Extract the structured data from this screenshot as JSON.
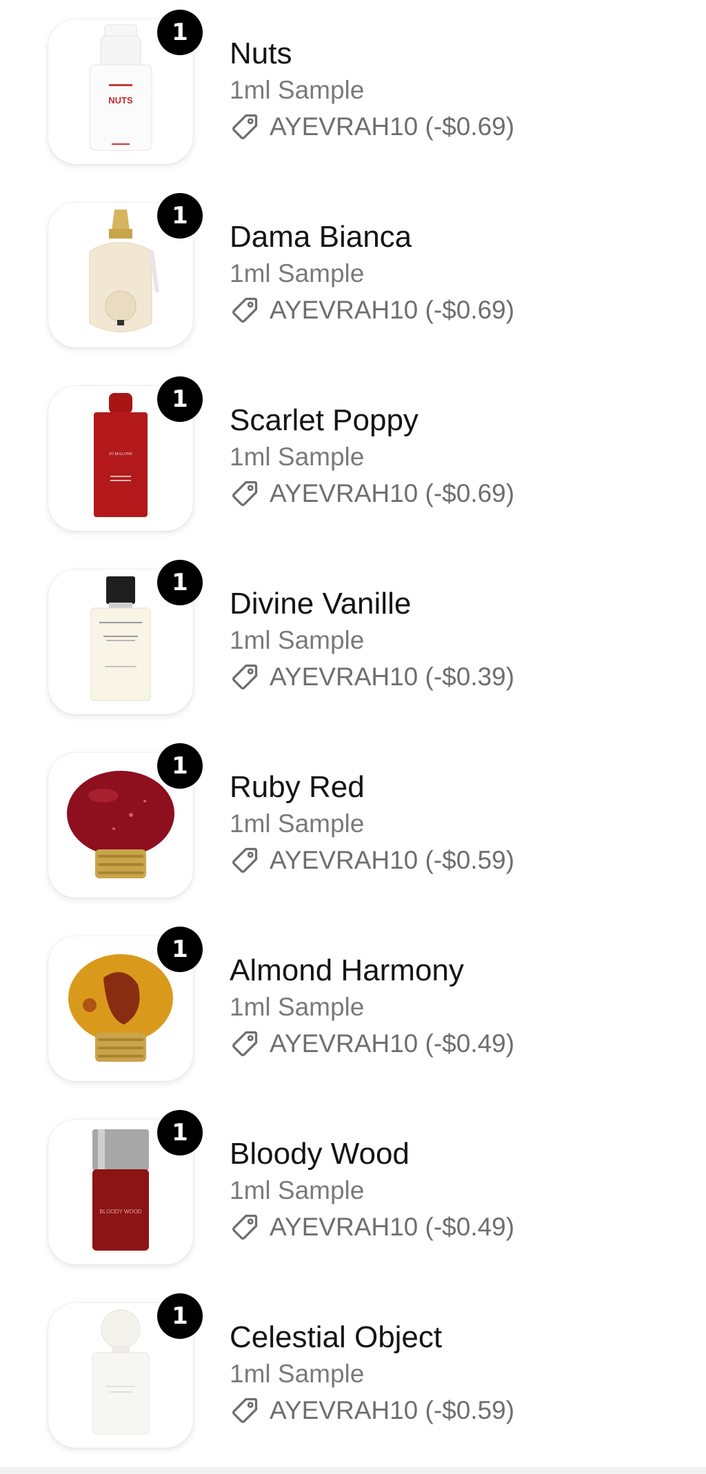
{
  "cart_items": [
    {
      "name": "Nuts",
      "variant": "1ml Sample",
      "discount": "AYEVRAH10 (-$0.69)",
      "quantity": "1",
      "image_icon": "perfume-bottle-white-icon",
      "label": "NUTS"
    },
    {
      "name": "Dama Bianca",
      "variant": "1ml Sample",
      "discount": "AYEVRAH10 (-$0.69)",
      "quantity": "1",
      "image_icon": "perfume-bottle-ivory-icon"
    },
    {
      "name": "Scarlet Poppy",
      "variant": "1ml Sample",
      "discount": "AYEVRAH10 (-$0.69)",
      "quantity": "1",
      "image_icon": "perfume-bottle-red-icon",
      "label": "JO MALONE"
    },
    {
      "name": "Divine Vanille",
      "variant": "1ml Sample",
      "discount": "AYEVRAH10 (-$0.39)",
      "quantity": "1",
      "image_icon": "perfume-bottle-clear-icon"
    },
    {
      "name": "Ruby Red",
      "variant": "1ml Sample",
      "discount": "AYEVRAH10 (-$0.59)",
      "quantity": "1",
      "image_icon": "perfume-bottle-ruby-icon"
    },
    {
      "name": "Almond Harmony",
      "variant": "1ml Sample",
      "discount": "AYEVRAH10 (-$0.49)",
      "quantity": "1",
      "image_icon": "perfume-bottle-amber-icon"
    },
    {
      "name": "Bloody Wood",
      "variant": "1ml Sample",
      "discount": "AYEVRAH10 (-$0.49)",
      "quantity": "1",
      "image_icon": "perfume-bottle-crimson-icon",
      "label": "BLOODY WOOD"
    },
    {
      "name": "Celestial Object",
      "variant": "1ml Sample",
      "discount": "AYEVRAH10 (-$0.59)",
      "quantity": "1",
      "image_icon": "perfume-bottle-frosted-icon"
    }
  ],
  "colors": {
    "badge": "#000000",
    "name_text": "#141414",
    "secondary_text": "#7a7a7a"
  }
}
